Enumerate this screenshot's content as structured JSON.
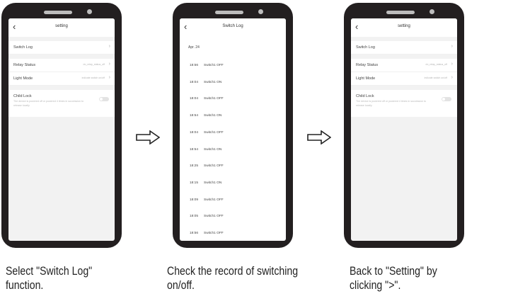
{
  "phones": [
    {
      "title": "setting",
      "rows": [
        {
          "label": "Switch Log",
          "value": ""
        }
      ],
      "rows2": [
        {
          "label": "Relay Status",
          "value": "do_relay_status_off"
        },
        {
          "label": "Light Mode",
          "value": "indicate switch on/off"
        }
      ],
      "child_lock": {
        "label": "Child Lock",
        "desc": "The device is powered off or powered 4 times in succession to release locally"
      }
    },
    {
      "title": "Switch Log",
      "date": "Apr. 24",
      "logs": [
        {
          "time": "18:56",
          "event": "Switch1 OFF"
        },
        {
          "time": "18:04",
          "event": "Switch1 ON"
        },
        {
          "time": "18:04",
          "event": "Switch1 OFF"
        },
        {
          "time": "18:54",
          "event": "Switch1 ON"
        },
        {
          "time": "18:04",
          "event": "Switch1 OFF"
        },
        {
          "time": "18:54",
          "event": "Switch1 ON"
        },
        {
          "time": "18:25",
          "event": "Switch1 OFF"
        },
        {
          "time": "18:15",
          "event": "Switch1 ON"
        },
        {
          "time": "18:09",
          "event": "Switch1 OFF"
        },
        {
          "time": "18:05",
          "event": "Switch1 OFF"
        },
        {
          "time": "18:56",
          "event": "Switch1 OFF"
        }
      ]
    },
    {
      "title": "setting",
      "rows": [
        {
          "label": "Switch Log",
          "value": ""
        }
      ],
      "rows2": [
        {
          "label": "Relay Status",
          "value": "do_relay_status_off"
        },
        {
          "label": "Light Mode",
          "value": "indicate switch on/off"
        }
      ],
      "child_lock": {
        "label": "Child Lock",
        "desc": "The device is powered off or powered 4 times in succession to release locally"
      }
    }
  ],
  "captions": [
    {
      "line1": "Select \"Switch Log\"",
      "line2": "function."
    },
    {
      "line1": "Check the record of switching",
      "line2": "on/off."
    },
    {
      "line1": "Back to \"Setting\" by",
      "line2": "clicking \">\"."
    }
  ],
  "icons": {
    "back": "chevron-left-icon",
    "next": "chevron-right-icon",
    "arrow": "right-arrow-icon"
  }
}
